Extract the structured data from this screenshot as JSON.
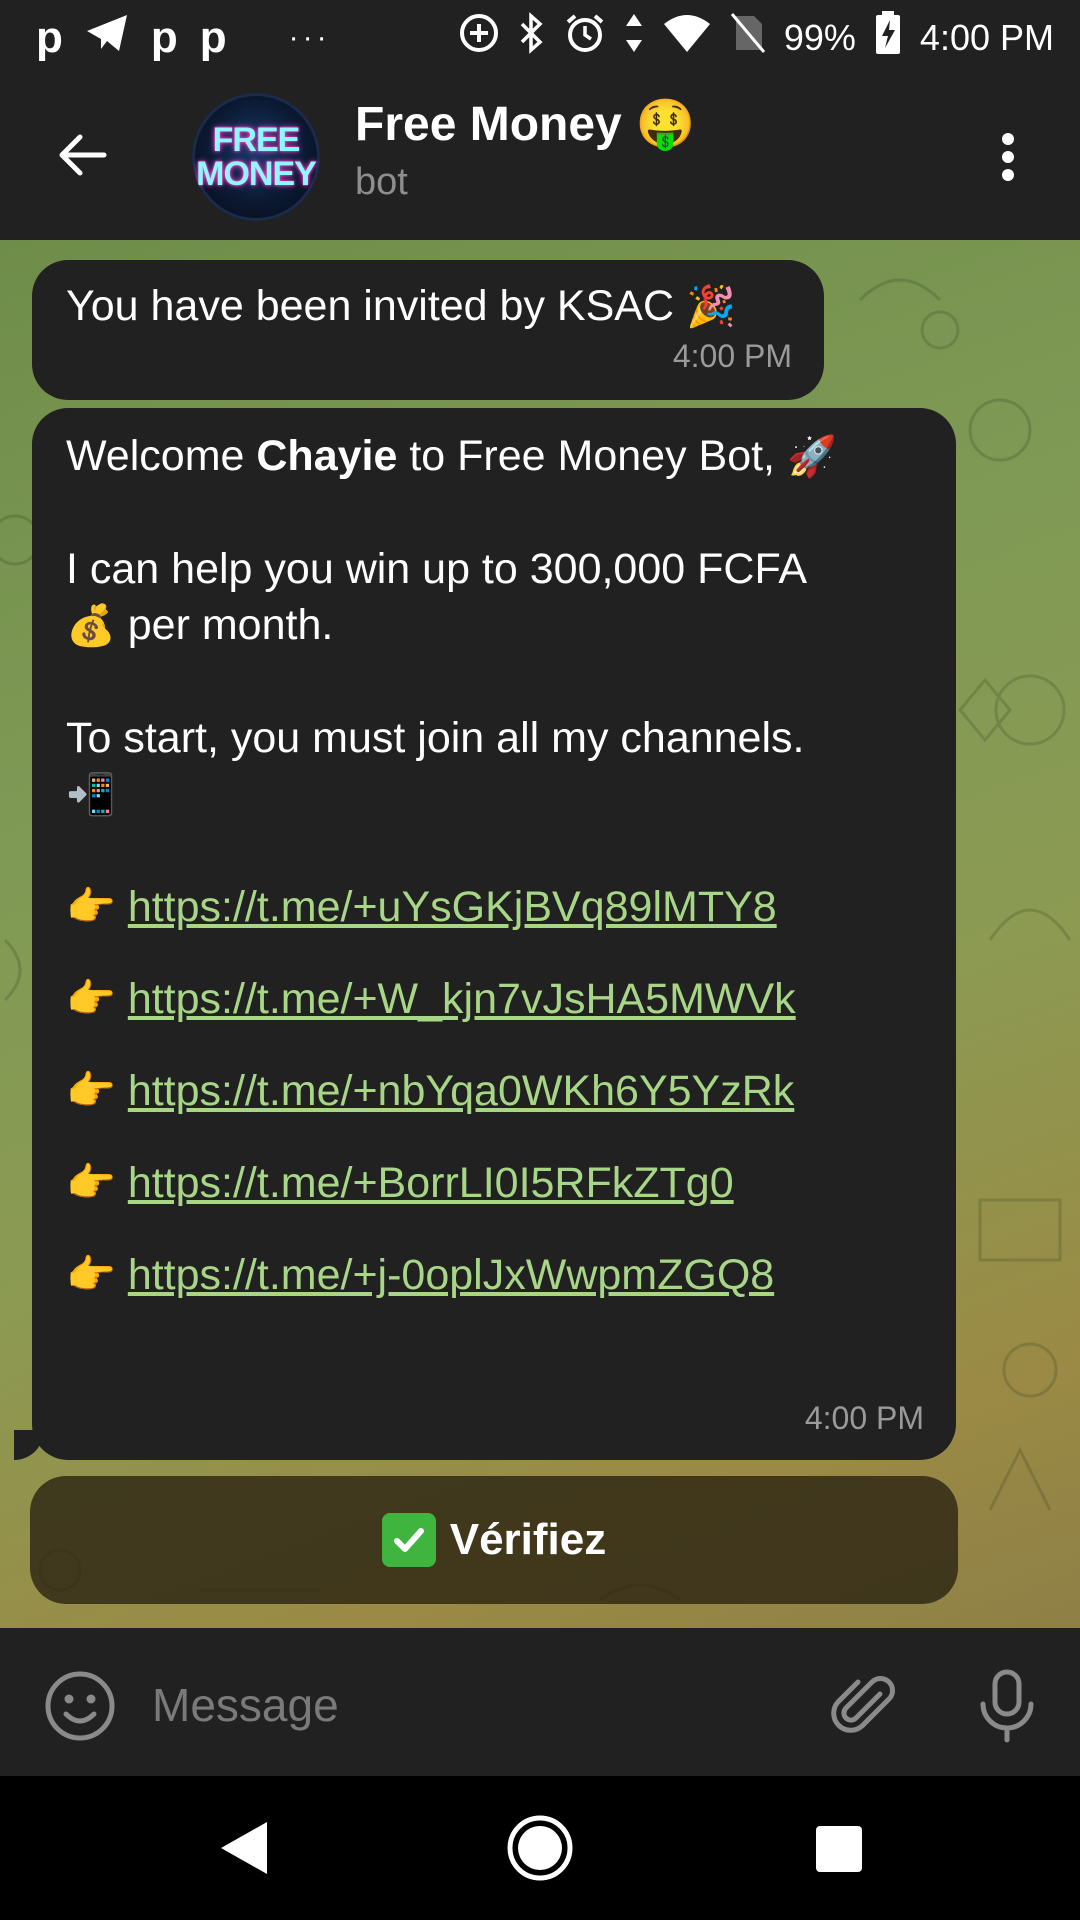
{
  "status_bar": {
    "left_icons": [
      "p-app-icon",
      "telegram-icon",
      "p-app-icon",
      "p-app-icon",
      "more-notifications-icon"
    ],
    "right_icons": [
      "data-saver-icon",
      "bluetooth-icon",
      "alarm-icon",
      "data-arrows-icon",
      "wifi-icon",
      "no-sim-icon",
      "battery-charging-icon"
    ],
    "battery": "99%",
    "time": "4:00 PM"
  },
  "header": {
    "avatar_text_line1": "FREE",
    "avatar_text_line2": "MONEY",
    "title": "Free Money",
    "title_emoji": "🤑",
    "subtitle": "bot"
  },
  "messages": [
    {
      "text": "You have been invited by KSAC",
      "emoji": "🎉",
      "time": "4:00 PM"
    },
    {
      "welcome_prefix": "Welcome ",
      "welcome_name": "Chayie",
      "welcome_suffix": " to Free Money Bot,",
      "welcome_emoji": "🚀",
      "win_line": "I can help you win up to 300,000 FCFA",
      "win_emoji": "💰",
      "win_suffix": " per month.",
      "join_line": "To start, you must join all my channels.",
      "join_emoji": "📲",
      "pointer_emoji": "👉",
      "links": [
        "https://t.me/+uYsGKjBVq89lMTY8",
        "https://t.me/+W_kjn7vJsHA5MWVk",
        "https://t.me/+nbYqa0WKh6Y5YzRk",
        "https://t.me/+BorrLI0I5RFkZTg0",
        "https://t.me/+j-0oplJxWwpmZGQ8"
      ],
      "time": "4:00 PM"
    }
  ],
  "verify_button": {
    "label": "Vérifiez",
    "icon": "check-mark-button-icon"
  },
  "input_bar": {
    "placeholder": "Message"
  },
  "colors": {
    "bubble": "#212121",
    "link": "#a7d686",
    "bar": "#212121"
  }
}
